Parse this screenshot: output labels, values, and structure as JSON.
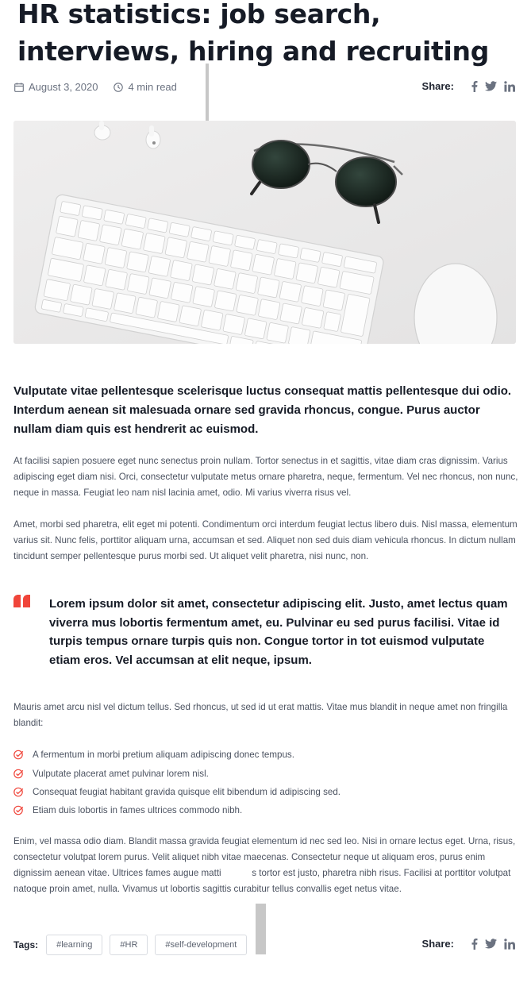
{
  "article": {
    "title": "HR statistics: job search,  interviews, hiring and recruiting",
    "date": "August 3, 2020",
    "read_time": "4 min read"
  },
  "share": {
    "label": "Share:",
    "icons": [
      "facebook-icon",
      "twitter-icon",
      "linkedin-icon"
    ]
  },
  "hero_image": {
    "subject": "White keyboard, earbuds, sunglasses and mouse on white desk"
  },
  "content": {
    "lead": "Vulputate vitae pellentesque scelerisque luctus consequat mattis pellentesque dui odio. Interdum aenean sit malesuada ornare sed gravida rhoncus, congue. Purus auctor nullam diam quis est hendrerit ac euismod.",
    "paragraphs": [
      "At facilisi sapien posuere eget nunc senectus proin nullam. Tortor senectus in et sagittis, vitae diam cras dignissim. Varius adipiscing eget diam nisi. Orci, consectetur vulputate metus ornare pharetra, neque, fermentum. Vel nec rhoncus, non nunc, neque in massa. Feugiat leo nam nisl lacinia amet, odio. Mi varius viverra risus vel.",
      "Amet, morbi sed pharetra, elit eget mi potenti. Condimentum orci interdum feugiat lectus libero duis. Nisl massa, elementum varius sit. Nunc felis, porttitor aliquam urna, accumsan et sed. Aliquet non sed duis diam vehicula rhoncus. In dictum nullam tincidunt semper pellentesque purus morbi sed. Ut aliquet velit pharetra, nisi nunc, non.",
      "Mauris amet arcu nisl vel dictum tellus. Sed rhoncus, ut sed id ut erat mattis. Vitae mus blandit in neque amet non fringilla blandit:",
      "Enim, vel massa odio diam. Blandit massa gravida feugiat elementum id nec sed leo. Nisi in ornare lectus eget. Urna, risus, consectetur volutpat lorem purus. Velit aliquet nibh vitae maecenas. Consectetur neque ut aliquam eros, purus enim dignissim aenean vitae. Ultrices fames augue matti            s tortor est justo, pharetra nibh risus. Facilisi at porttitor volutpat natoque proin amet, nulla. Vivamus ut lobortis sagittis curabitur tellus convallis eget netus vitae."
    ],
    "quote": "Lorem ipsum dolor sit amet, consectetur adipiscing elit. Justo, amet lectus quam viverra mus lobortis fermentum amet, eu. Pulvinar eu sed purus  facilisi. Vitae id turpis tempus ornare turpis quis non. Congue tortor in tot euismod vulputate etiam eros. Vel accumsan at elit neque, ipsum.",
    "checklist": [
      "A fermentum in morbi pretium aliquam adipiscing donec tempus.",
      "Vulputate placerat amet pulvinar lorem nisl.",
      "Consequat feugiat habitant gravida quisque elit bibendum id adipiscing sed.",
      "Etiam duis lobortis in fames ultrices commodo nibh."
    ]
  },
  "tags": {
    "label": "Tags:",
    "items": [
      "#learning",
      "#HR",
      "#self-development"
    ]
  },
  "colors": {
    "accent": "#f0453a",
    "text": "#161b26",
    "body_text": "#4b5260",
    "muted": "#6b7280"
  }
}
